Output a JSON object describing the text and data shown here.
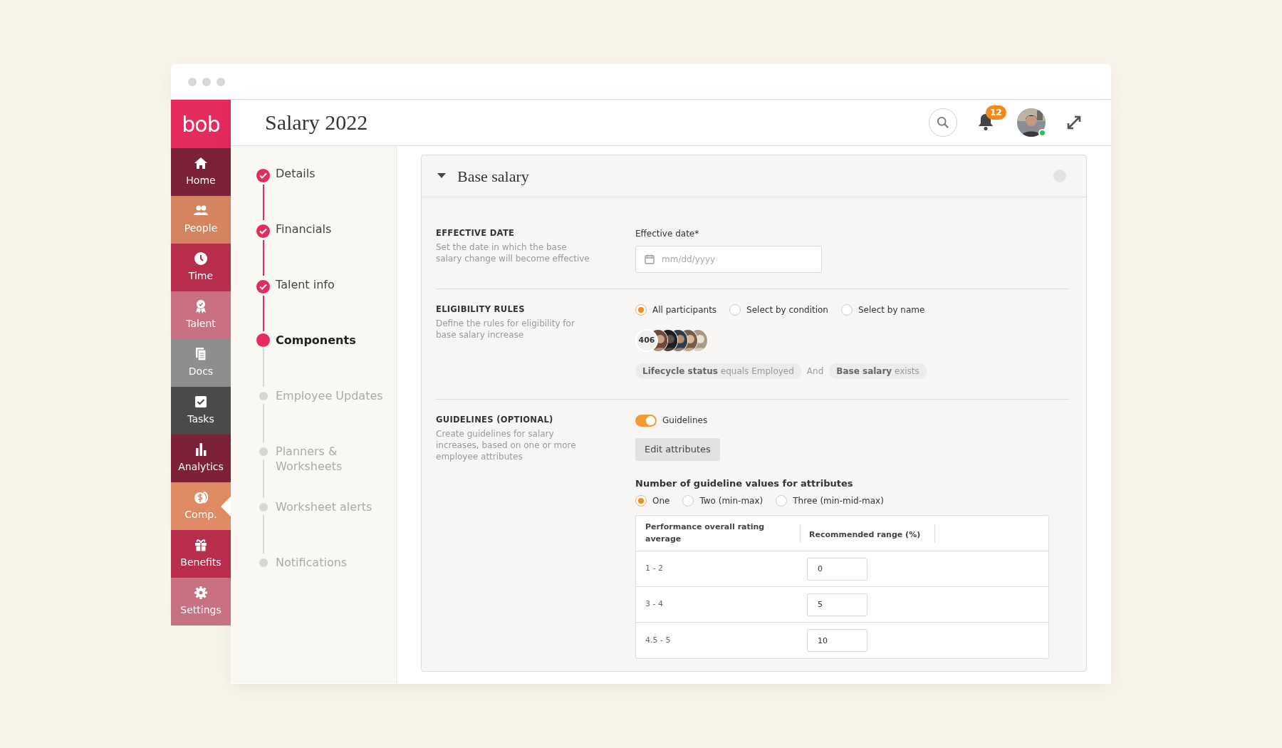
{
  "window": {
    "title": "Salary 2022"
  },
  "logo": "bob",
  "sidebar": {
    "items": [
      {
        "label": "Home",
        "color": "#7b2239",
        "selected": false
      },
      {
        "label": "People",
        "color": "#d4855f",
        "selected": false
      },
      {
        "label": "Time",
        "color": "#b72d4b",
        "selected": false
      },
      {
        "label": "Talent",
        "color": "#c77182",
        "selected": false
      },
      {
        "label": "Docs",
        "color": "#8e8e8e",
        "selected": false
      },
      {
        "label": "Tasks",
        "color": "#4a4a4a",
        "selected": false
      },
      {
        "label": "Analytics",
        "color": "#7d2139",
        "selected": false
      },
      {
        "label": "Comp.",
        "color": "#de8a63",
        "selected": true
      },
      {
        "label": "Benefits",
        "color": "#b72d4b",
        "selected": false
      },
      {
        "label": "Settings",
        "color": "#c77182",
        "selected": false
      }
    ]
  },
  "header": {
    "notification_count": "12",
    "user": {
      "online": true
    }
  },
  "steps": [
    {
      "label": "Details",
      "done": true,
      "selected": false
    },
    {
      "label": "Financials",
      "done": true,
      "selected": false
    },
    {
      "label": "Talent info",
      "done": true,
      "selected": false
    },
    {
      "label": "Components",
      "done": false,
      "selected": true
    },
    {
      "label": "Employee Updates",
      "done": false,
      "selected": false
    },
    {
      "label": "Planners & Worksheets",
      "done": false,
      "selected": false
    },
    {
      "label": "Worksheet alerts",
      "done": false,
      "selected": false
    },
    {
      "label": "Notifications",
      "done": false,
      "selected": false
    }
  ],
  "panel": {
    "title": "Base salary",
    "expanded": true,
    "effective_date": {
      "heading": "EFFECTIVE DATE",
      "description": "Set the date in which the base salary change will become effective",
      "field_label": "Effective date*",
      "placeholder": "mm/dd/yyyy"
    },
    "eligibility": {
      "heading": "ELIGIBILITY RULES",
      "description": "Define the rules for eligibility for base salary increase",
      "options": [
        {
          "label": "All participants",
          "selected": true
        },
        {
          "label": "Select by condition",
          "selected": false
        },
        {
          "label": "Select by name",
          "selected": false
        }
      ],
      "count": "406",
      "conditions": [
        "**Lifecycle status** equals Employed",
        "**Base salary** exists"
      ],
      "joiner": "And"
    },
    "guidelines": {
      "heading": "GUIDELINES (OPTIONAL)",
      "description": "Create guidelines for salary increases, based on one or more employee attributes",
      "toggle": {
        "label": "Guidelines",
        "on": true
      },
      "button": "Edit attributes",
      "values_title": "Number of guideline values for attributes",
      "options": [
        {
          "label": "One",
          "selected": true
        },
        {
          "label": "Two (min-max)",
          "selected": false
        },
        {
          "label": "Three (min-mid-max)",
          "selected": false
        }
      ],
      "table": {
        "columns": [
          "Performance overall rating average",
          "Recommended range (%)"
        ],
        "rows": [
          {
            "rating": "1 - 2",
            "value": "0"
          },
          {
            "rating": "3 - 4",
            "value": "5"
          },
          {
            "rating": "4.5 - 5",
            "value": "10"
          }
        ]
      }
    }
  }
}
